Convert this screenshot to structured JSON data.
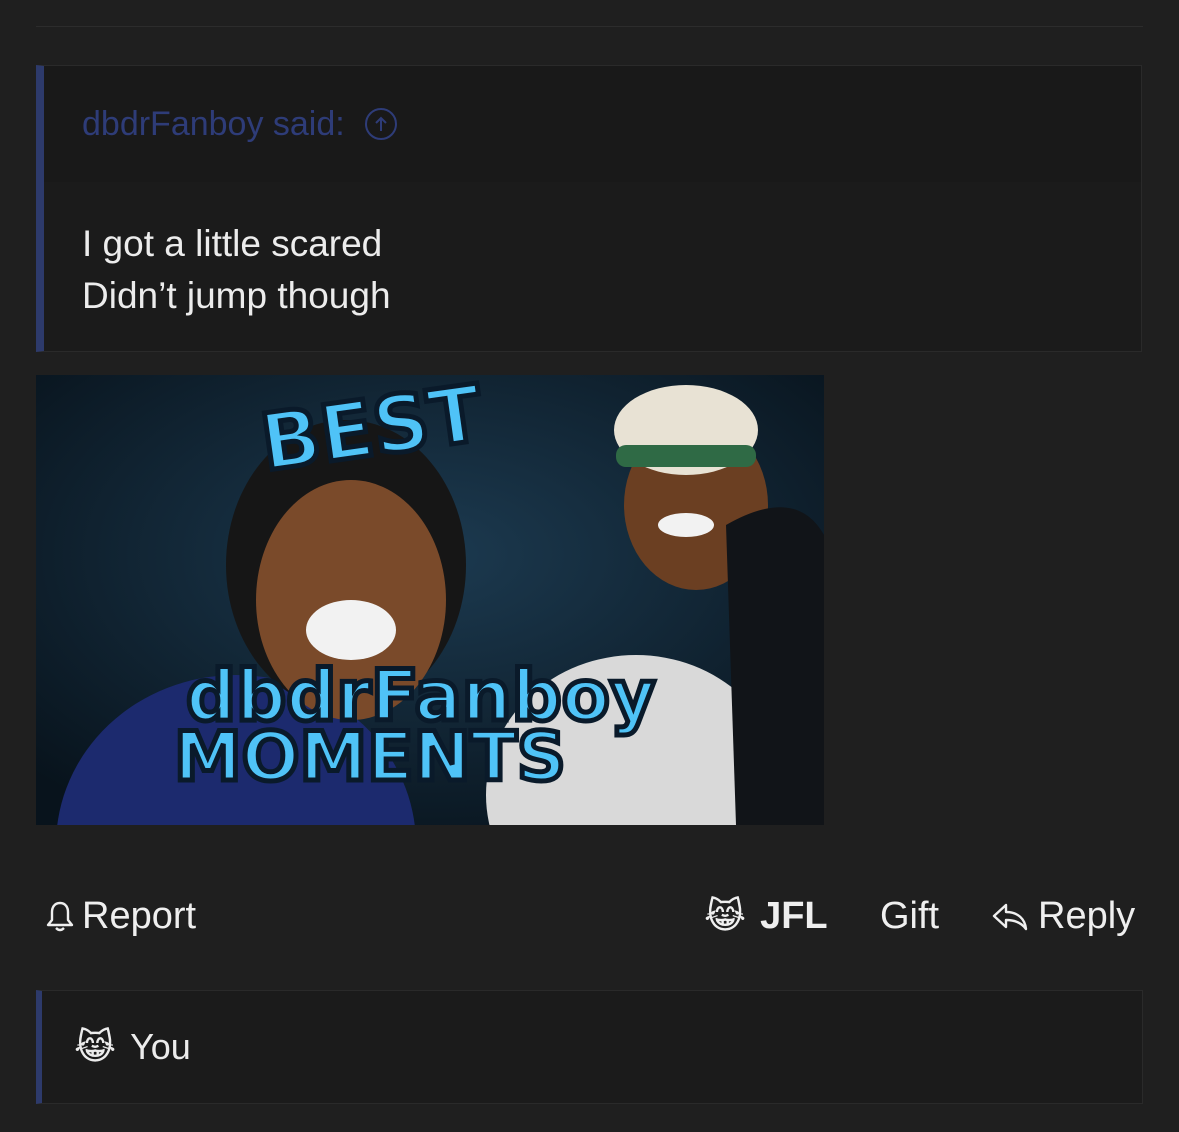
{
  "quote": {
    "author_label": "dbdrFanboy said:",
    "lines": [
      "I got a little scared",
      "Didn’t jump though"
    ],
    "jump_icon": "arrow-up-circle-icon"
  },
  "media": {
    "caption_top": "BEST",
    "caption_name": "dbdrFanboy",
    "caption_bottom": "MOMENTS"
  },
  "actions": {
    "report_label": "Report",
    "report_icon": "bell-icon",
    "reaction_emoji": "😹",
    "reaction_label": "JFL",
    "gift_label": "Gift",
    "reply_label": "Reply",
    "reply_icon": "reply-arrow-icon"
  },
  "reactions": {
    "emoji": "😹",
    "label": "You"
  },
  "colors": {
    "background": "#1f1f1f",
    "quote_accent": "#2d3a6b",
    "quote_author": "#2e3c78",
    "text": "#ececec"
  }
}
